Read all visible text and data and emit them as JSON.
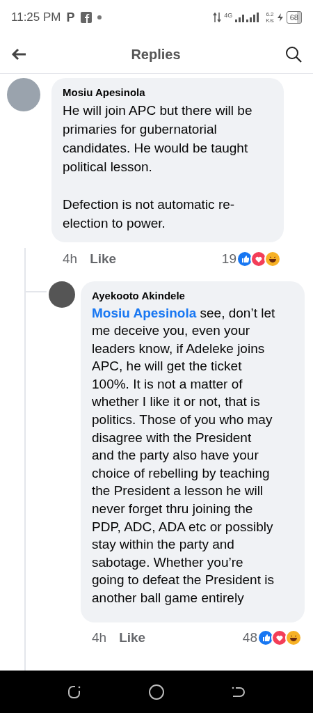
{
  "status_bar": {
    "time": "11:25 PM",
    "notification_letter": "P",
    "network": "4G",
    "speed_value": "6.2",
    "speed_unit": "K/s",
    "battery": "68"
  },
  "header": {
    "title": "Replies"
  },
  "comment": {
    "author": "Mosiu Apesinola",
    "paragraphs": [
      "He will join APC but there will be primaries for gubernatorial candidates. He would be taught political lesson.",
      "Defection is not automatic re-election to power."
    ],
    "time": "4h",
    "like": "Like",
    "reaction_count": "19"
  },
  "reply": {
    "author": "Ayekooto Akindele",
    "mention": "Mosiu Apesinola",
    "text": " see, don’t let me deceive you, even your leaders know, if Adeleke joins APC, he will get the ticket 100%. It is not a matter of whether I like it or not, that is politics. Those of you who may disagree with the President and the party also have your choice of rebelling by teaching the President a lesson he will never forget thru joining the PDP, ADC, ADA etc or possibly stay within the party and sabotage. Whether you’re going to defeat the President is another ball game entirely",
    "time": "4h",
    "like": "Like",
    "reaction_count": "48"
  }
}
